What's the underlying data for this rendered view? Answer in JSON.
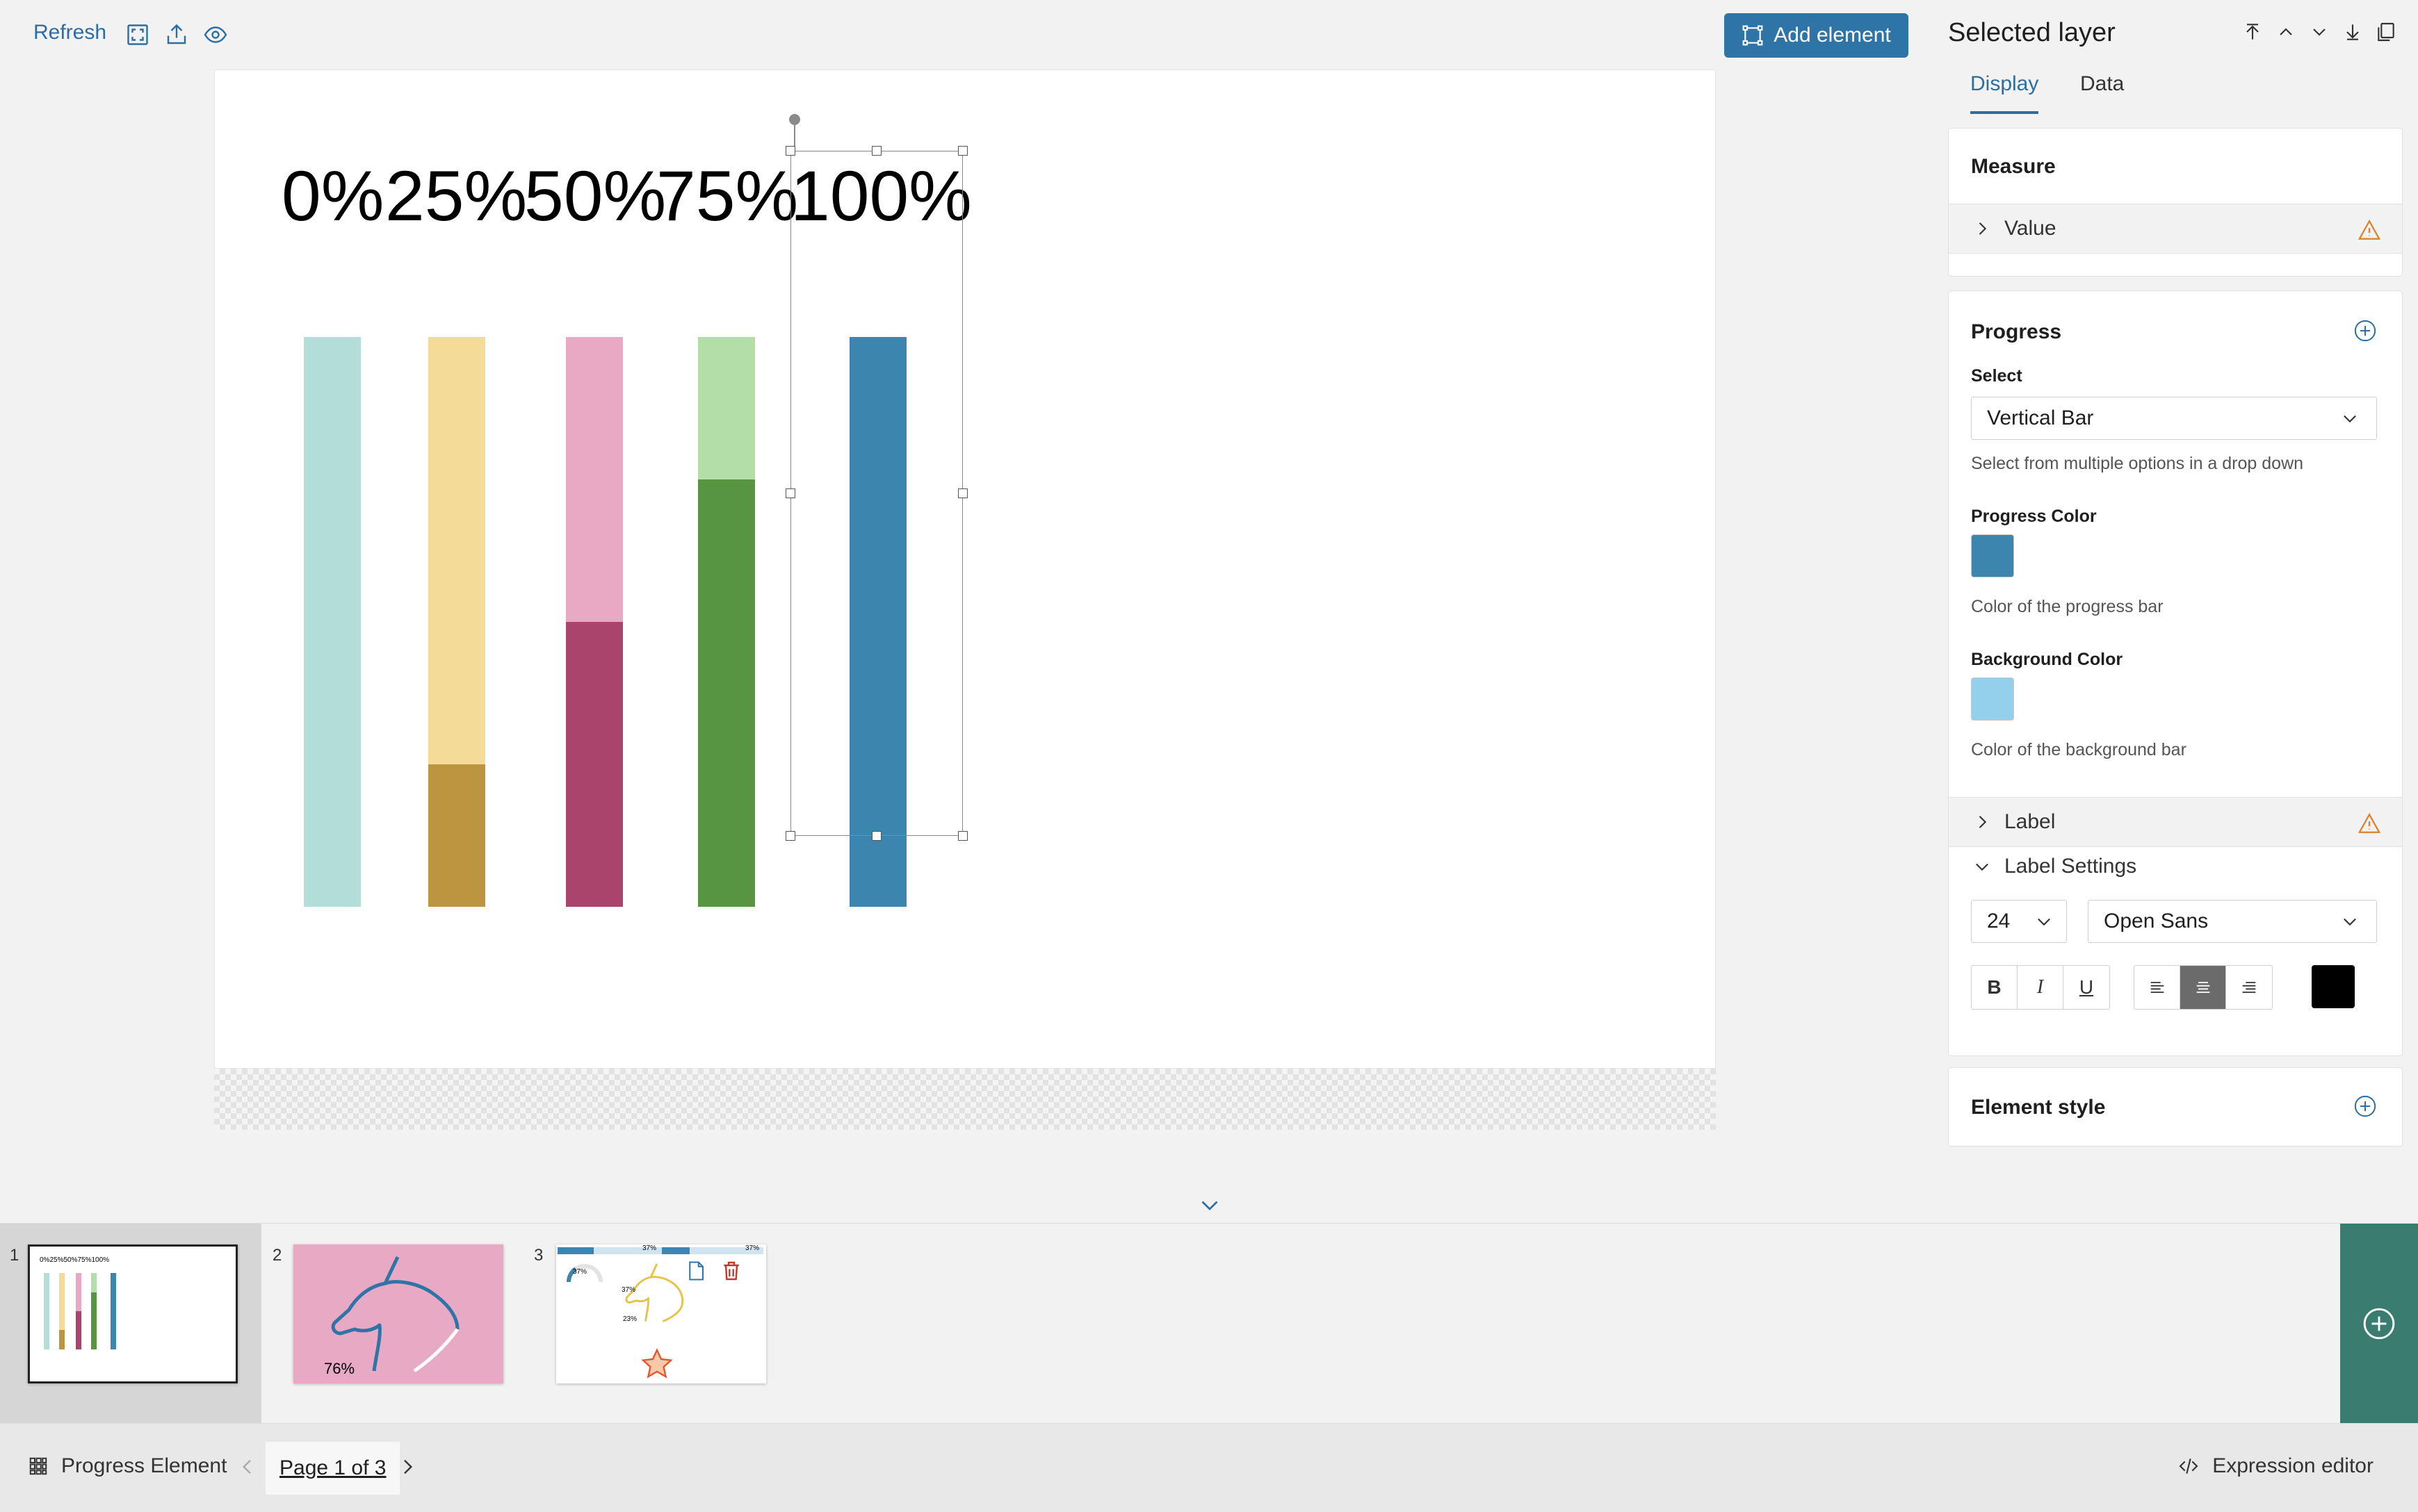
{
  "toolbar": {
    "refresh_label": "Refresh",
    "icons": [
      "fit-screen-icon",
      "export-icon",
      "preview-eye-icon"
    ],
    "add_element_label": "Add element",
    "accent_color": "#2f74a6"
  },
  "canvas": {
    "percent_labels": [
      "0%",
      "25%",
      "50%",
      "75%",
      "100%"
    ],
    "bars": [
      {
        "value": 0,
        "background": "#b2ddd9",
        "progress": "#5fb8b0"
      },
      {
        "value": 0.25,
        "background": "#f4dc98",
        "progress": "#bd9440"
      },
      {
        "value": 0.5,
        "background": "#e9a9c4",
        "progress": "#ab446c"
      },
      {
        "value": 0.75,
        "background": "#b3dea8",
        "progress": "#579543"
      },
      {
        "value": 1,
        "background": "#94cfeb",
        "progress": "#3b85ae"
      }
    ]
  },
  "panel": {
    "title": "Selected layer",
    "tabs": [
      {
        "label": "Display",
        "active": true
      },
      {
        "label": "Data",
        "active": false
      }
    ],
    "measure": {
      "title": "Measure",
      "value_row": "Value"
    },
    "progress": {
      "title": "Progress",
      "select_label": "Select",
      "select_value": "Vertical Bar",
      "select_help": "Select from multiple options in a drop down",
      "progress_color_label": "Progress Color",
      "progress_color": "#3b85ae",
      "progress_color_help": "Color of the progress bar",
      "background_color_label": "Background Color",
      "background_color": "#94cfeb",
      "background_color_help": "Color of the background bar",
      "label_row": "Label",
      "label_settings_row": "Label Settings",
      "font_size": "24",
      "font_family": "Open Sans",
      "format_buttons": [
        "B",
        "I",
        "U"
      ],
      "text_color": "#000000"
    },
    "element_style": {
      "title": "Element style"
    }
  },
  "pages": {
    "thumbnails": [
      {
        "number": "1",
        "labels": "0%25%50%75%100%"
      },
      {
        "number": "2",
        "label": "76%",
        "background": "#e8a9c4"
      },
      {
        "number": "3",
        "labels": [
          "37%",
          "37%",
          "37%",
          "37%",
          "23%"
        ]
      }
    ]
  },
  "status": {
    "document_name": "Progress Element",
    "page_indicator": "Page 1 of 3",
    "expression_editor": "Expression editor"
  }
}
